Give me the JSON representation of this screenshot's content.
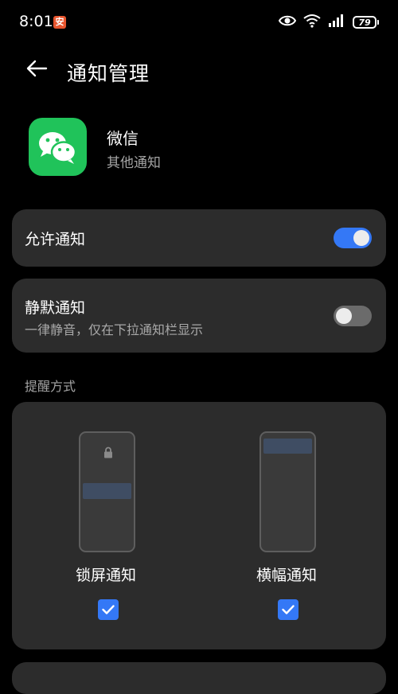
{
  "status_bar": {
    "time": "8:01",
    "notification_badge": "安",
    "battery_level": "79"
  },
  "header": {
    "title": "通知管理"
  },
  "app": {
    "name": "微信",
    "subtitle": "其他通知",
    "icon": "wechat-icon"
  },
  "allow_notification": {
    "label": "允许通知",
    "enabled": true
  },
  "silent_notification": {
    "label": "静默通知",
    "description": "一律静音，仅在下拉通知栏显示",
    "enabled": false
  },
  "reminder": {
    "section_label": "提醒方式",
    "options": [
      {
        "label": "锁屏通知",
        "checked": true
      },
      {
        "label": "横幅通知",
        "checked": true
      }
    ]
  },
  "colors": {
    "background": "#000000",
    "card": "#2c2c2c",
    "accent": "#3478f6",
    "wechat_green": "#20c35a"
  }
}
